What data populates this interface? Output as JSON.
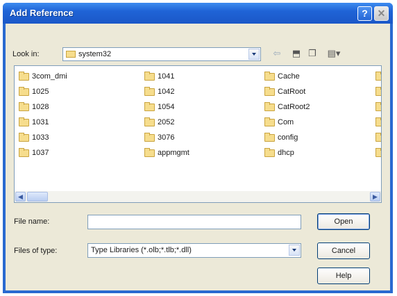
{
  "window": {
    "title": "Add Reference",
    "help_glyph": "?"
  },
  "look_in": {
    "label": "Look in:",
    "value": "system32"
  },
  "files": [
    [
      "3com_dmi",
      "1041",
      "Cache"
    ],
    [
      "1025",
      "1042",
      "CatRoot"
    ],
    [
      "1028",
      "1054",
      "CatRoot2"
    ],
    [
      "1031",
      "2052",
      "Com"
    ],
    [
      "1033",
      "3076",
      "config"
    ],
    [
      "1037",
      "appmgmt",
      "dhcp"
    ]
  ],
  "file_name": {
    "label": "File name:",
    "value": ""
  },
  "files_of_type": {
    "label": "Files of type:",
    "value": "Type Libraries (*.olb;*.tlb;*.dll)"
  },
  "buttons": {
    "open": "Open",
    "cancel": "Cancel",
    "help": "Help"
  },
  "colors": {
    "titlebar": "#2a6ad0",
    "client": "#ece9d8",
    "folder": "#f6dd8d"
  }
}
